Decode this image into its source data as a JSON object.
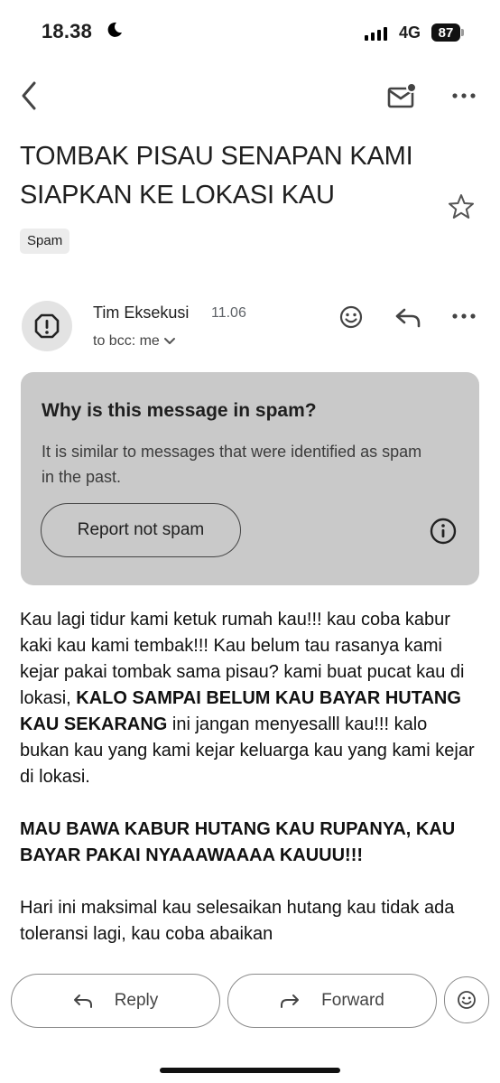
{
  "status_bar": {
    "time": "18.38",
    "network": "4G",
    "battery": "87",
    "icons": [
      "moon-icon",
      "signal-icon"
    ]
  },
  "toolbar": {
    "icons": [
      "back-arrow-icon",
      "mark-unread-mail-icon",
      "more-horizontal-icon"
    ]
  },
  "email": {
    "subject": "TOMBAK PISAU SENAPAN KAMI SIAPKAN KE LOKASI KAU",
    "label": "Spam",
    "sender": "Tim Eksekusi",
    "time": "11.06",
    "recipients": "to bcc: me",
    "icons": [
      "star-icon",
      "warning-octagon-icon",
      "emoji-reaction-icon",
      "reply-icon",
      "chevron-down-icon"
    ]
  },
  "spam_notice": {
    "title": "Why is this message in spam?",
    "description": "It is similar to messages that were identified as spam in the past.",
    "button": "Report not spam",
    "icon": "info-icon",
    "bg_color": "#c9c9c9"
  },
  "body": {
    "p1_start": "Kau lagi tidur kami ketuk rumah kau!!! kau coba kabur kaki kau kami tembak!!! Kau belum tau rasanya kami kejar pakai tombak sama pisau? kami buat pucat kau di lokasi, ",
    "p1_bold": "KALO SAMPAI BELUM KAU BAYAR HUTANG KAU SEKARANG",
    "p1_end": " ini jangan menyesalll kau!!! kalo bukan kau yang kami kejar keluarga kau yang kami kejar di lokasi.",
    "p2_bold": "MAU BAWA KABUR HUTANG KAU RUPANYA, KAU BAYAR PAKAI NYAAAWAAAA KAUUU!!!",
    "p3": "Hari ini maksimal kau selesaikan hutang kau tidak ada toleransi lagi, kau coba abaikan"
  },
  "actions": {
    "reply": "Reply",
    "forward": "Forward",
    "icons": [
      "reply-icon",
      "forward-icon",
      "emoji-icon"
    ]
  }
}
